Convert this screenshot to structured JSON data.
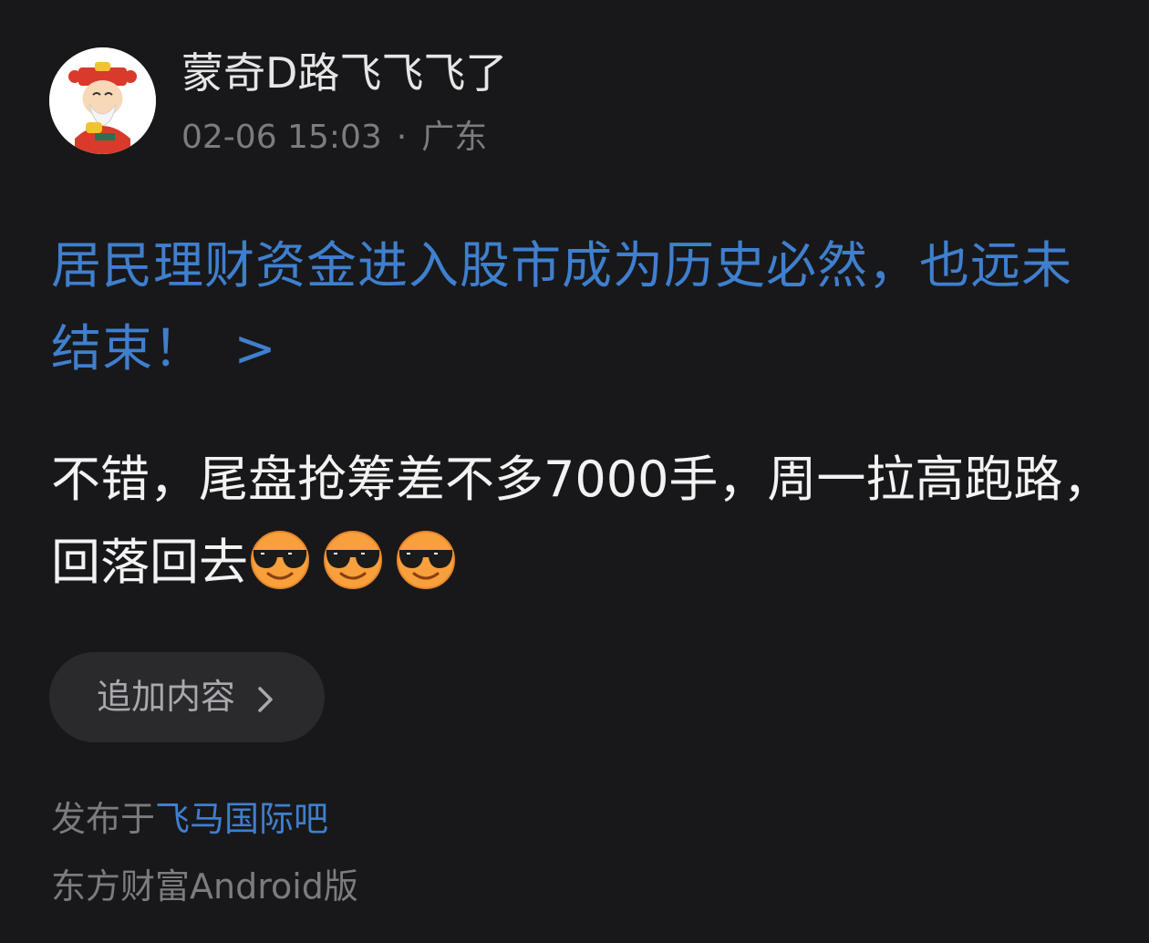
{
  "author": {
    "name": "蒙奇D路飞飞飞了",
    "date": "02-06 15:03",
    "separator": "·",
    "location": "广东",
    "avatar_icon": "fortune-god-avatar"
  },
  "post": {
    "title": "居民理财资金进入股市成为历史必然，也远未结束！",
    "title_arrow": ">",
    "body": "不错，尾盘抢筹差不多7000手，周一拉高跑路，回落回去",
    "emoji_icon": "smiling-face-with-sunglasses-icon"
  },
  "actions": {
    "append_label": "追加内容"
  },
  "footer": {
    "published_prefix": "发布于",
    "forum_name": "飞马国际吧",
    "source": "东方财富Android版"
  },
  "colors": {
    "background": "#18181a",
    "link": "#3f7fce",
    "muted": "#7b7b80"
  }
}
